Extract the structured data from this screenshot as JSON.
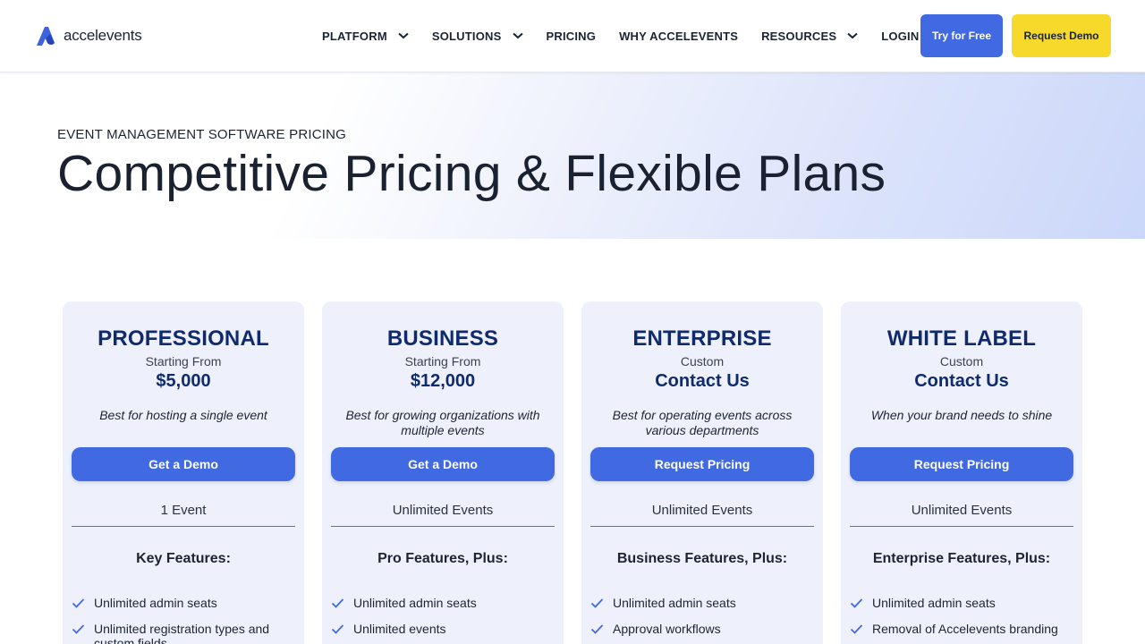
{
  "brand": {
    "name": "accelevents"
  },
  "nav": {
    "items": [
      {
        "label": "PLATFORM",
        "dropdown": true
      },
      {
        "label": "SOLUTIONS",
        "dropdown": true
      },
      {
        "label": "PRICING",
        "dropdown": false
      },
      {
        "label": "WHY ACCELEVENTS",
        "dropdown": false
      },
      {
        "label": "RESOURCES",
        "dropdown": true
      },
      {
        "label": "LOGIN",
        "dropdown": false
      }
    ],
    "try_label": "Try for Free",
    "demo_label": "Request Demo"
  },
  "hero": {
    "eyebrow": "EVENT MANAGEMENT SOFTWARE PRICING",
    "title": "Competitive Pricing & Flexible Plans"
  },
  "plans": [
    {
      "name": "PROFESSIONAL",
      "sub": "Starting From",
      "price": "$5,000",
      "desc": "Best for hosting a single event",
      "button": "Get a Demo",
      "events": "1 Event",
      "features_title": "Key Features:",
      "features": [
        "Unlimited admin seats",
        "Unlimited registration types and custom fields"
      ]
    },
    {
      "name": "BUSINESS",
      "sub": "Starting From",
      "price": "$12,000",
      "desc": "Best for growing organizations with multiple events",
      "button": "Get a Demo",
      "events": "Unlimited Events",
      "features_title": "Pro Features, Plus:",
      "features": [
        "Unlimited admin seats",
        "Unlimited events"
      ]
    },
    {
      "name": "ENTERPRISE",
      "sub": "Custom",
      "price": "Contact Us",
      "desc": "Best for operating events across various departments",
      "button": "Request Pricing",
      "events": "Unlimited Events",
      "features_title": "Business Features, Plus:",
      "features": [
        "Unlimited admin seats",
        "Approval workflows"
      ]
    },
    {
      "name": "WHITE LABEL",
      "sub": "Custom",
      "price": "Contact Us",
      "desc": "When your brand needs to shine",
      "button": "Request Pricing",
      "events": "Unlimited Events",
      "features_title": "Enterprise Features, Plus:",
      "features": [
        "Unlimited admin seats",
        "Removal of Accelevents branding"
      ]
    }
  ],
  "colors": {
    "primary": "#4169e1",
    "accent": "#f7d92c",
    "heading": "#0f2b6e",
    "card_bg": "#eef1fc"
  }
}
